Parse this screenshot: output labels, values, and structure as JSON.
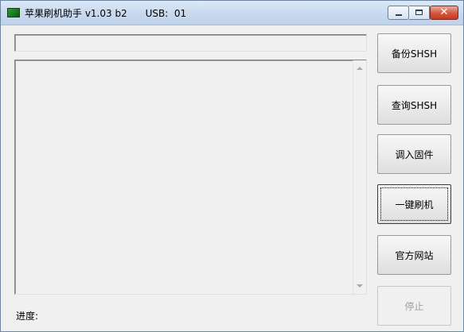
{
  "window": {
    "title": "苹果刷机助手 v1.03 b2      USB:  01",
    "close_glyph": "✕"
  },
  "status": {
    "top_field_value": ""
  },
  "log": {
    "content": ""
  },
  "progress": {
    "label": "进度:"
  },
  "buttons": {
    "backup_shsh": "备份SHSH",
    "query_shsh": "查询SHSH",
    "load_firmware": "调入固件",
    "one_click_flash": "一键刷机",
    "official_site": "官方网站",
    "stop": "停止"
  }
}
